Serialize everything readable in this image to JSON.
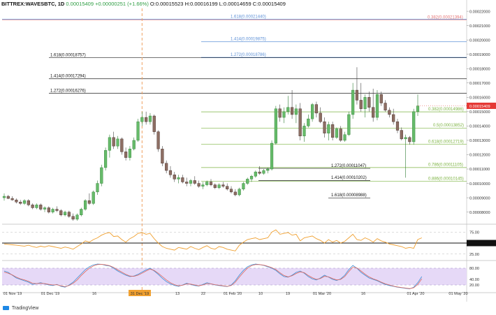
{
  "header": {
    "symbol": "BITTREX:WAVESBTC, 1D",
    "change": "0.00015409 +0.00000251 (+1.66%)",
    "open": "O:0.00015523",
    "high": "H:0.00016199",
    "low": "L:0.00014659",
    "close": "C:0.00015409"
  },
  "logo_text": "TradingView",
  "colors": {
    "up": "#2f9e44",
    "down": "#c0392b",
    "fib_green": "#7cb342",
    "fib_blue": "#5b8fd6",
    "fib_red": "#e57373",
    "fib_black": "#222222",
    "rsi": "#f0a030",
    "stoch_fill": "#e6d9f7",
    "price_label": "#e53935"
  },
  "chart_data": [
    {
      "type": "candlestick",
      "title": "",
      "x_tick_labels": [
        "01 Nov '19",
        "01 Dec '19",
        "16",
        "31 Dec '19",
        "13",
        "22",
        "01 Feb '20",
        "10",
        "19",
        "01 Mar '20",
        "16",
        "01 Apr '20",
        "01 May '20"
      ],
      "y_tick_labels": [
        "0.00022000",
        "0.00021000",
        "0.00020000",
        "0.00019000",
        "0.00018000",
        "0.00017000",
        "0.00016000",
        "0.00015000",
        "0.00014000",
        "0.00013000",
        "0.00012000",
        "0.00011000",
        "0.00010000",
        "0.00009000",
        "0.00008000"
      ],
      "ylim": [
        7.3e-05,
        0.000222
      ],
      "last_price_label": "0.00015409",
      "highlighted_date": "31 Dec '19",
      "fib_levels": [
        {
          "label": "1.618(0.00021440)",
          "value": 0.0002144,
          "color": "blue"
        },
        {
          "label": "0.382(0.00021394)",
          "value": 0.00021394,
          "color": "red"
        },
        {
          "label": "1.414(0.00019875)",
          "value": 0.00019875,
          "color": "blue"
        },
        {
          "label": "1.272(0.00018786)",
          "value": 0.00018786,
          "color": "blue"
        },
        {
          "label": "1.618(0.00018757)",
          "value": 0.00018757,
          "color": "black"
        },
        {
          "label": "1.414(0.00017294)",
          "value": 0.00017294,
          "color": "black"
        },
        {
          "label": "1.272(0.00016276)",
          "value": 0.00016276,
          "color": "black"
        },
        {
          "label": "0.382(0.00014986)",
          "value": 0.00014986,
          "color": "green"
        },
        {
          "label": "0.5(0.00013852)",
          "value": 0.00013852,
          "color": "green"
        },
        {
          "label": "0.618(0.00012719)",
          "value": 0.00012719,
          "color": "green"
        },
        {
          "label": "1.272(0.00011047)",
          "value": 0.00011047,
          "color": "black"
        },
        {
          "label": "0.786(0.00011105)",
          "value": 0.00011105,
          "color": "green"
        },
        {
          "label": "1.414(0.00010202)",
          "value": 0.00010202,
          "color": "black"
        },
        {
          "label": "0.886(0.00010145)",
          "value": 0.00010145,
          "color": "green"
        },
        {
          "label": "1.618(0.00008988)",
          "value": 8.988e-05,
          "color": "black"
        }
      ],
      "candles": [
        {
          "o": 9.0,
          "h": 9.3,
          "l": 8.8,
          "c": 9.1
        },
        {
          "o": 9.1,
          "h": 9.2,
          "l": 8.9,
          "c": 8.95
        },
        {
          "o": 8.95,
          "h": 9.1,
          "l": 8.8,
          "c": 8.85
        },
        {
          "o": 8.85,
          "h": 8.95,
          "l": 8.6,
          "c": 8.7
        },
        {
          "o": 8.7,
          "h": 8.85,
          "l": 8.5,
          "c": 8.6
        },
        {
          "o": 8.6,
          "h": 8.9,
          "l": 8.5,
          "c": 8.8
        },
        {
          "o": 8.8,
          "h": 8.9,
          "l": 8.4,
          "c": 8.5
        },
        {
          "o": 8.5,
          "h": 8.6,
          "l": 8.2,
          "c": 8.3
        },
        {
          "o": 8.3,
          "h": 8.6,
          "l": 8.2,
          "c": 8.5
        },
        {
          "o": 8.5,
          "h": 8.6,
          "l": 8.1,
          "c": 8.2
        },
        {
          "o": 8.2,
          "h": 8.4,
          "l": 8.0,
          "c": 8.3
        },
        {
          "o": 8.3,
          "h": 8.4,
          "l": 7.9,
          "c": 8.0
        },
        {
          "o": 8.0,
          "h": 8.3,
          "l": 7.9,
          "c": 8.2
        },
        {
          "o": 8.2,
          "h": 8.4,
          "l": 8.0,
          "c": 8.1
        },
        {
          "o": 8.1,
          "h": 8.2,
          "l": 7.7,
          "c": 7.8
        },
        {
          "o": 7.8,
          "h": 8.1,
          "l": 7.7,
          "c": 8.0
        },
        {
          "o": 8.0,
          "h": 8.1,
          "l": 7.6,
          "c": 7.7
        },
        {
          "o": 7.7,
          "h": 7.9,
          "l": 7.4,
          "c": 7.5
        },
        {
          "o": 7.5,
          "h": 7.9,
          "l": 7.4,
          "c": 7.8
        },
        {
          "o": 7.8,
          "h": 8.3,
          "l": 7.7,
          "c": 8.2
        },
        {
          "o": 8.2,
          "h": 8.9,
          "l": 8.1,
          "c": 8.8
        },
        {
          "o": 8.8,
          "h": 9.3,
          "l": 8.5,
          "c": 8.6
        },
        {
          "o": 8.6,
          "h": 9.5,
          "l": 8.5,
          "c": 9.4
        },
        {
          "o": 9.4,
          "h": 10.2,
          "l": 9.2,
          "c": 10.0
        },
        {
          "o": 10.0,
          "h": 11.3,
          "l": 9.8,
          "c": 11.1
        },
        {
          "o": 11.1,
          "h": 12.5,
          "l": 10.9,
          "c": 12.3
        },
        {
          "o": 12.3,
          "h": 13.4,
          "l": 11.8,
          "c": 13.2
        },
        {
          "o": 13.2,
          "h": 13.6,
          "l": 12.4,
          "c": 12.6
        },
        {
          "o": 12.6,
          "h": 13.3,
          "l": 12.4,
          "c": 13.1
        },
        {
          "o": 13.1,
          "h": 13.2,
          "l": 12.0,
          "c": 12.2
        },
        {
          "o": 12.2,
          "h": 12.5,
          "l": 11.6,
          "c": 11.8
        },
        {
          "o": 11.8,
          "h": 12.6,
          "l": 11.6,
          "c": 12.4
        },
        {
          "o": 12.4,
          "h": 13.2,
          "l": 12.3,
          "c": 13.0
        },
        {
          "o": 13.0,
          "h": 14.5,
          "l": 12.9,
          "c": 14.3
        },
        {
          "o": 14.3,
          "h": 15.0,
          "l": 14.0,
          "c": 14.6
        },
        {
          "o": 14.6,
          "h": 15.0,
          "l": 14.1,
          "c": 14.3
        },
        {
          "o": 14.3,
          "h": 14.9,
          "l": 14.1,
          "c": 14.7
        },
        {
          "o": 14.7,
          "h": 14.8,
          "l": 13.4,
          "c": 13.6
        },
        {
          "o": 13.6,
          "h": 13.7,
          "l": 12.2,
          "c": 12.4
        },
        {
          "o": 12.4,
          "h": 12.6,
          "l": 11.2,
          "c": 11.4
        },
        {
          "o": 11.4,
          "h": 11.6,
          "l": 10.7,
          "c": 10.9
        },
        {
          "o": 10.9,
          "h": 11.2,
          "l": 10.4,
          "c": 10.6
        },
        {
          "o": 10.6,
          "h": 10.8,
          "l": 10.1,
          "c": 10.3
        },
        {
          "o": 10.3,
          "h": 10.6,
          "l": 10.0,
          "c": 10.4
        },
        {
          "o": 10.4,
          "h": 10.6,
          "l": 10.0,
          "c": 10.1
        },
        {
          "o": 10.1,
          "h": 10.4,
          "l": 9.8,
          "c": 10.0
        },
        {
          "o": 10.0,
          "h": 10.3,
          "l": 9.8,
          "c": 10.2
        },
        {
          "o": 10.2,
          "h": 10.5,
          "l": 9.9,
          "c": 10.0
        },
        {
          "o": 10.0,
          "h": 10.2,
          "l": 9.7,
          "c": 9.8
        },
        {
          "o": 9.8,
          "h": 10.1,
          "l": 9.6,
          "c": 9.9
        },
        {
          "o": 9.9,
          "h": 10.2,
          "l": 9.8,
          "c": 10.1
        },
        {
          "o": 10.1,
          "h": 10.3,
          "l": 9.8,
          "c": 9.9
        },
        {
          "o": 9.9,
          "h": 10.0,
          "l": 9.6,
          "c": 9.7
        },
        {
          "o": 9.7,
          "h": 10.0,
          "l": 9.6,
          "c": 9.9
        },
        {
          "o": 9.9,
          "h": 10.1,
          "l": 9.7,
          "c": 9.8
        },
        {
          "o": 9.8,
          "h": 10.0,
          "l": 9.5,
          "c": 9.6
        },
        {
          "o": 9.6,
          "h": 9.8,
          "l": 9.3,
          "c": 9.4
        },
        {
          "o": 9.4,
          "h": 9.6,
          "l": 9.1,
          "c": 9.2
        },
        {
          "o": 9.2,
          "h": 9.7,
          "l": 9.1,
          "c": 9.6
        },
        {
          "o": 9.6,
          "h": 10.1,
          "l": 9.5,
          "c": 10.0
        },
        {
          "o": 10.0,
          "h": 10.4,
          "l": 9.9,
          "c": 10.3
        },
        {
          "o": 10.3,
          "h": 10.6,
          "l": 10.1,
          "c": 10.5
        },
        {
          "o": 10.5,
          "h": 10.9,
          "l": 10.4,
          "c": 10.8
        },
        {
          "o": 10.8,
          "h": 11.2,
          "l": 10.6,
          "c": 10.7
        },
        {
          "o": 10.7,
          "h": 11.0,
          "l": 10.6,
          "c": 10.9
        },
        {
          "o": 10.9,
          "h": 11.1,
          "l": 10.7,
          "c": 11.0
        },
        {
          "o": 11.0,
          "h": 13.0,
          "l": 10.9,
          "c": 12.8
        },
        {
          "o": 12.8,
          "h": 15.4,
          "l": 12.7,
          "c": 15.2
        },
        {
          "o": 15.2,
          "h": 15.5,
          "l": 14.3,
          "c": 14.6
        },
        {
          "o": 14.6,
          "h": 15.3,
          "l": 14.2,
          "c": 15.0
        },
        {
          "o": 15.0,
          "h": 16.1,
          "l": 14.8,
          "c": 15.3
        },
        {
          "o": 15.3,
          "h": 16.5,
          "l": 14.5,
          "c": 14.8
        },
        {
          "o": 14.8,
          "h": 15.5,
          "l": 14.2,
          "c": 15.2
        },
        {
          "o": 15.2,
          "h": 15.6,
          "l": 13.0,
          "c": 13.3
        },
        {
          "o": 13.3,
          "h": 14.2,
          "l": 12.9,
          "c": 14.0
        },
        {
          "o": 14.0,
          "h": 14.8,
          "l": 13.9,
          "c": 14.5
        },
        {
          "o": 14.5,
          "h": 15.6,
          "l": 14.3,
          "c": 15.5
        },
        {
          "o": 15.5,
          "h": 15.7,
          "l": 14.6,
          "c": 14.9
        },
        {
          "o": 14.9,
          "h": 15.3,
          "l": 14.2,
          "c": 14.3
        },
        {
          "o": 14.3,
          "h": 14.6,
          "l": 13.2,
          "c": 13.5
        },
        {
          "o": 13.5,
          "h": 14.3,
          "l": 13.0,
          "c": 14.1
        },
        {
          "o": 14.1,
          "h": 14.3,
          "l": 13.0,
          "c": 13.2
        },
        {
          "o": 13.2,
          "h": 13.9,
          "l": 13.1,
          "c": 13.8
        },
        {
          "o": 13.8,
          "h": 14.0,
          "l": 12.9,
          "c": 13.0
        },
        {
          "o": 13.0,
          "h": 13.6,
          "l": 12.9,
          "c": 13.4
        },
        {
          "o": 13.4,
          "h": 15.0,
          "l": 13.3,
          "c": 14.8
        },
        {
          "o": 14.8,
          "h": 17.0,
          "l": 14.5,
          "c": 16.5
        },
        {
          "o": 16.5,
          "h": 18.1,
          "l": 15.5,
          "c": 15.8
        },
        {
          "o": 15.8,
          "h": 17.0,
          "l": 15.0,
          "c": 15.2
        },
        {
          "o": 15.2,
          "h": 16.2,
          "l": 14.6,
          "c": 16.0
        },
        {
          "o": 16.0,
          "h": 16.4,
          "l": 15.0,
          "c": 15.3
        },
        {
          "o": 15.3,
          "h": 16.6,
          "l": 14.3,
          "c": 14.6
        },
        {
          "o": 14.6,
          "h": 16.5,
          "l": 14.4,
          "c": 16.2
        },
        {
          "o": 16.2,
          "h": 16.4,
          "l": 15.4,
          "c": 15.6
        },
        {
          "o": 15.6,
          "h": 15.8,
          "l": 15.0,
          "c": 15.1
        },
        {
          "o": 15.1,
          "h": 15.3,
          "l": 14.6,
          "c": 14.8
        },
        {
          "o": 14.8,
          "h": 15.2,
          "l": 14.1,
          "c": 14.3
        },
        {
          "o": 14.3,
          "h": 14.5,
          "l": 13.5,
          "c": 13.7
        },
        {
          "o": 13.7,
          "h": 13.9,
          "l": 13.0,
          "c": 13.1
        },
        {
          "o": 13.1,
          "h": 13.4,
          "l": 10.4,
          "c": 13.2
        },
        {
          "o": 13.2,
          "h": 13.3,
          "l": 12.7,
          "c": 12.9
        },
        {
          "o": 12.9,
          "h": 15.2,
          "l": 12.7,
          "c": 15.0
        },
        {
          "o": 15.0,
          "h": 16.2,
          "l": 14.7,
          "c": 15.4
        }
      ]
    },
    {
      "type": "line",
      "title": "",
      "y_tick_labels": [
        "75.00",
        "50.00",
        "25.00"
      ],
      "ylim": [
        15,
        85
      ],
      "reference_line": 50,
      "values": [
        48,
        47,
        46,
        45,
        44,
        43,
        45,
        42,
        40,
        43,
        41,
        44,
        42,
        40,
        38,
        41,
        39,
        36,
        42,
        48,
        55,
        52,
        58,
        62,
        68,
        72,
        74,
        65,
        66,
        58,
        52,
        60,
        65,
        72,
        74,
        70,
        72,
        60,
        50,
        42,
        38,
        36,
        34,
        40,
        38,
        36,
        42,
        38,
        35,
        40,
        44,
        38,
        36,
        42,
        40,
        36,
        34,
        32,
        45,
        52,
        58,
        60,
        62,
        58,
        60,
        62,
        75,
        80,
        70,
        72,
        74,
        68,
        70,
        55,
        62,
        64,
        66,
        60,
        56,
        50,
        58,
        52,
        56,
        50,
        54,
        62,
        70,
        58,
        56,
        62,
        58,
        52,
        60,
        55,
        52,
        48,
        46,
        44,
        42,
        38,
        40,
        38,
        58,
        62
      ]
    },
    {
      "type": "area",
      "title": "",
      "y_tick_labels": [
        "80.00",
        "40.00",
        "20.00"
      ],
      "ylim": [
        0,
        100
      ],
      "series": [
        {
          "values": [
            70,
            65,
            55,
            45,
            40,
            35,
            30,
            22,
            25,
            28,
            24,
            20,
            18,
            22,
            15,
            12,
            20,
            30,
            45,
            60,
            75,
            85,
            92,
            95,
            94,
            90,
            88,
            80,
            70,
            62,
            55,
            50,
            52,
            58,
            66,
            74,
            80,
            70,
            58,
            44,
            32,
            24,
            18,
            15,
            20,
            26,
            22,
            18,
            16,
            22,
            28,
            24,
            20,
            18,
            16,
            14,
            20,
            35,
            55,
            72,
            85,
            92,
            95,
            93,
            90,
            85,
            80,
            72,
            60,
            50,
            48,
            55,
            65,
            70,
            62,
            50,
            42,
            38,
            45,
            55,
            48,
            40,
            36,
            42,
            55,
            75,
            90,
            80,
            65,
            55,
            45,
            40,
            35,
            28,
            22,
            18,
            15,
            12,
            10,
            8,
            6,
            12,
            28,
            50
          ]
        },
        {
          "values": [
            66,
            62,
            56,
            48,
            42,
            38,
            33,
            26,
            25,
            26,
            25,
            22,
            20,
            21,
            17,
            14,
            18,
            26,
            38,
            54,
            68,
            80,
            88,
            93,
            94,
            92,
            89,
            83,
            74,
            66,
            58,
            52,
            51,
            55,
            62,
            70,
            77,
            72,
            62,
            50,
            38,
            28,
            21,
            17,
            19,
            24,
            23,
            20,
            17,
            20,
            25,
            24,
            21,
            19,
            17,
            15,
            18,
            30,
            48,
            65,
            80,
            89,
            93,
            93,
            91,
            87,
            82,
            75,
            64,
            54,
            49,
            53,
            61,
            67,
            64,
            54,
            46,
            40,
            43,
            51,
            49,
            43,
            38,
            40,
            50,
            68,
            84,
            81,
            70,
            59,
            49,
            42,
            37,
            30,
            24,
            20,
            16,
            13,
            11,
            9,
            7,
            10,
            22,
            42
          ]
        }
      ]
    }
  ]
}
